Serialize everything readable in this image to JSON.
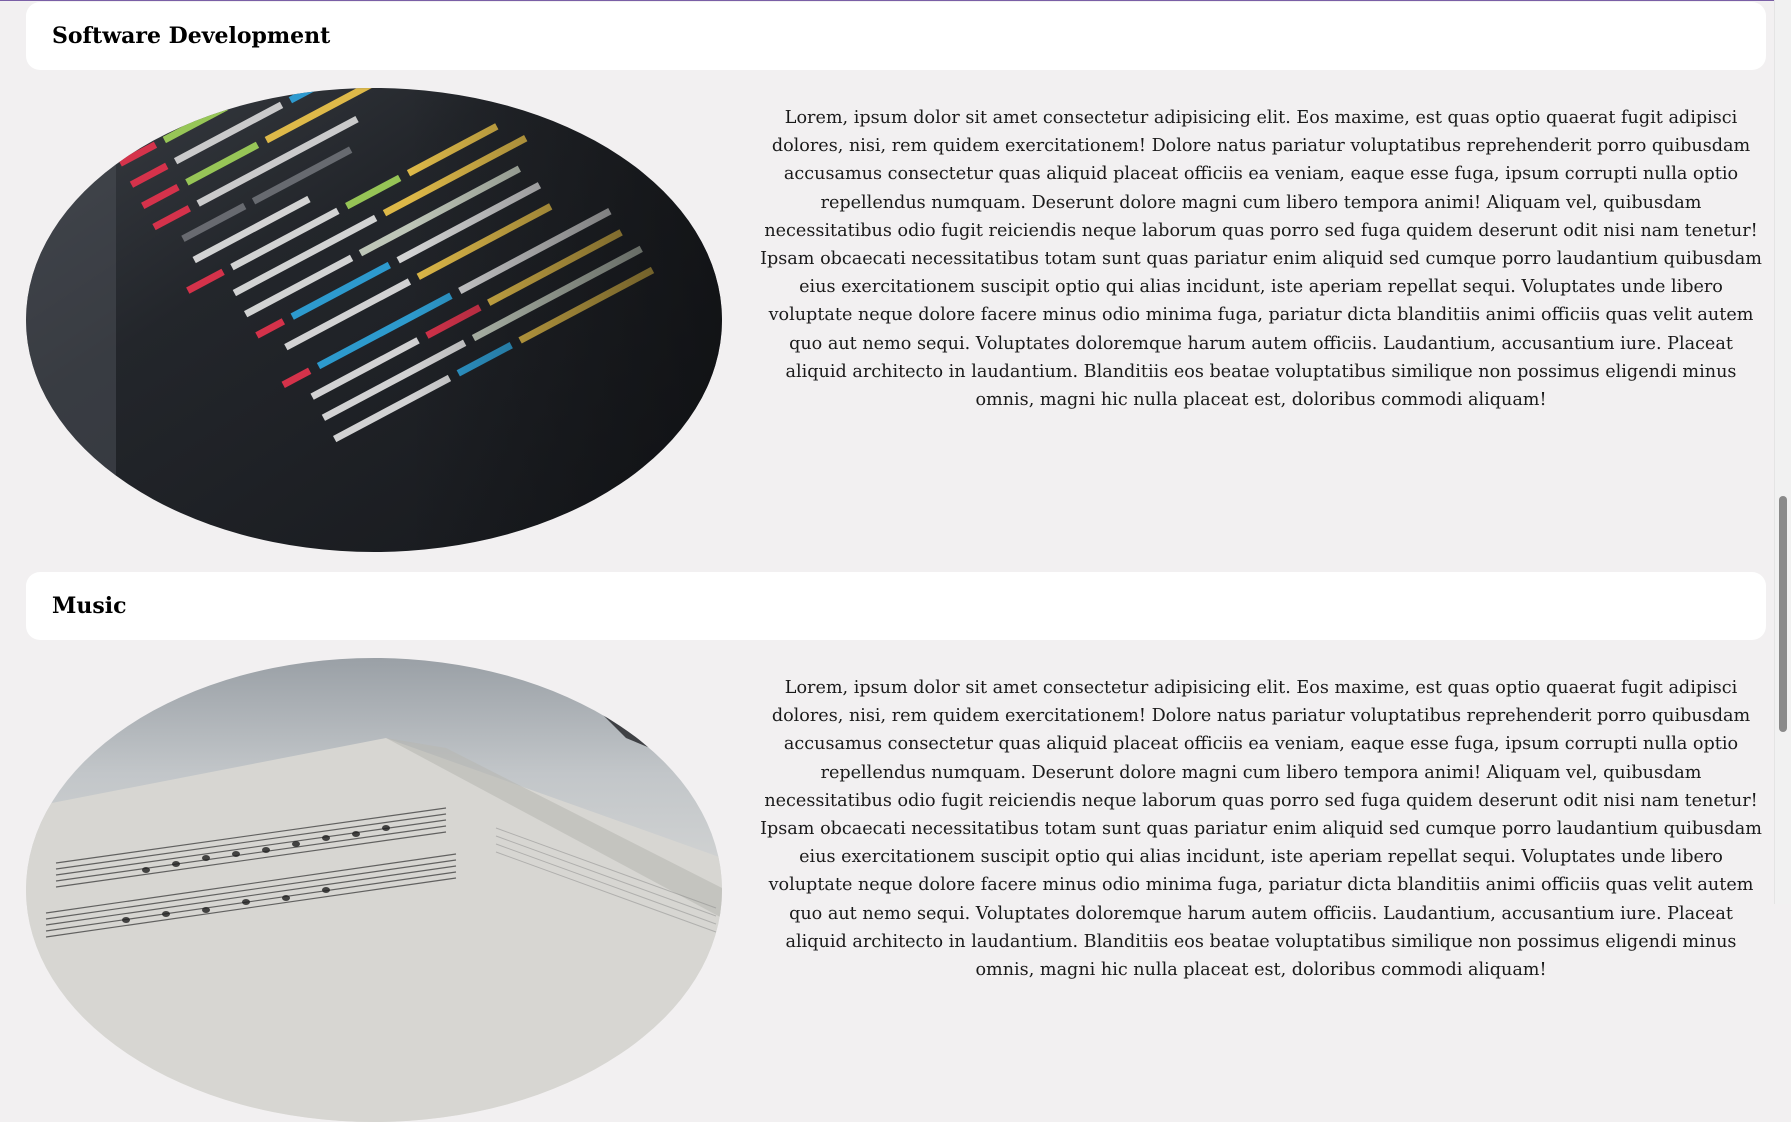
{
  "sections": [
    {
      "title": "Software Development",
      "image_alt": "code-screenshot",
      "text": "Lorem, ipsum dolor sit amet consectetur adipisicing elit. Eos maxime, est quas optio quaerat fugit adipisci dolores, nisi, rem quidem exercitationem! Dolore natus pariatur voluptatibus reprehenderit porro quibusdam accusamus consectetur quas aliquid placeat officiis ea veniam, eaque esse fuga, ipsum corrupti nulla optio repellendus numquam. Deserunt dolore magni cum libero tempora animi! Aliquam vel, quibusdam necessitatibus odio fugit reiciendis neque laborum quas porro sed fuga quidem deserunt odit nisi nam tenetur! Ipsam obcaecati necessitatibus totam sunt quas pariatur enim aliquid sed cumque porro laudantium quibusdam eius exercitationem suscipit optio qui alias incidunt, iste aperiam repellat sequi. Voluptates unde libero voluptate neque dolore facere minus odio minima fuga, pariatur dicta blanditiis animi officiis quas velit autem quo aut nemo sequi. Voluptates doloremque harum autem officiis. Laudantium, accusantium iure. Placeat aliquid architecto in laudantium. Blanditiis eos beatae voluptatibus similique non possimus eligendi minus omnis, magni hic nulla placeat est, doloribus commodi aliquam!"
    },
    {
      "title": "Music",
      "image_alt": "sheet-music-photo",
      "text": "Lorem, ipsum dolor sit amet consectetur adipisicing elit. Eos maxime, est quas optio quaerat fugit adipisci dolores, nisi, rem quidem exercitationem! Dolore natus pariatur voluptatibus reprehenderit porro quibusdam accusamus consectetur quas aliquid placeat officiis ea veniam, eaque esse fuga, ipsum corrupti nulla optio repellendus numquam. Deserunt dolore magni cum libero tempora animi! Aliquam vel, quibusdam necessitatibus odio fugit reiciendis neque laborum quas porro sed fuga quidem deserunt odit nisi nam tenetur! Ipsam obcaecati necessitatibus totam sunt quas pariatur enim aliquid sed cumque porro laudantium quibusdam eius exercitationem suscipit optio qui alias incidunt, iste aperiam repellat sequi. Voluptates unde libero voluptate neque dolore facere minus odio minima fuga, pariatur dicta blanditiis animi officiis quas velit autem quo aut nemo sequi. Voluptates doloremque harum autem officiis. Laudantium, accusantium iure. Placeat aliquid architecto in laudantium. Blanditiis eos beatae voluptatibus similique non possimus eligendi minus omnis, magni hic nulla placeat est, doloribus commodi aliquam!"
    }
  ],
  "colors": {
    "page_background": "#f2f0f1",
    "card_background": "#ffffff",
    "top_border": "#7a5fa6"
  },
  "scrollbar": {
    "position_fraction": 0.55
  }
}
